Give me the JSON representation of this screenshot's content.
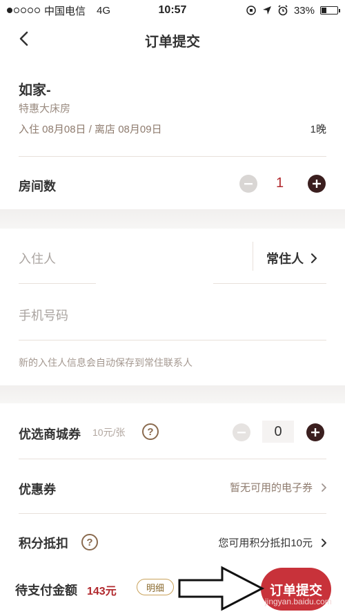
{
  "status_bar": {
    "carrier": "中国电信",
    "network": "4G",
    "time": "10:57",
    "battery_percent": "33%",
    "battery_level": 0.33
  },
  "nav": {
    "title": "订单提交"
  },
  "hotel": {
    "name": "如家-",
    "room_type": "特惠大床房",
    "dates": "入住 08月08日 / 离店 08月09日",
    "nights": "1晚"
  },
  "rooms": {
    "label": "房间数",
    "quantity": "1"
  },
  "guest": {
    "label": "入住人",
    "frequent_label": "常住人",
    "phone_label": "手机号码",
    "hint": "新的入住人信息会自动保存到常住联系人"
  },
  "mall_coupon": {
    "label": "优选商城券",
    "price": "10元/张",
    "help": "?",
    "quantity": "0"
  },
  "coupon": {
    "label": "优惠券",
    "value": "暂无可用的电子券"
  },
  "points": {
    "label": "积分抵扣",
    "help": "?",
    "value": "您可用积分抵扣10元"
  },
  "footer": {
    "pay_label": "待支付金额",
    "pay_amount": "143元",
    "detail_label": "明细",
    "submit_label": "订单提交",
    "watermark": "jingyan.baidu.com"
  },
  "colors": {
    "accent_red": "#b1282d",
    "button_red": "#c8323a",
    "dark_brown": "#3b1f1f"
  },
  "icons": [
    "back-icon",
    "plus-icon",
    "minus-icon",
    "chevron-right-icon",
    "help-icon",
    "arrow-annotation-icon"
  ]
}
